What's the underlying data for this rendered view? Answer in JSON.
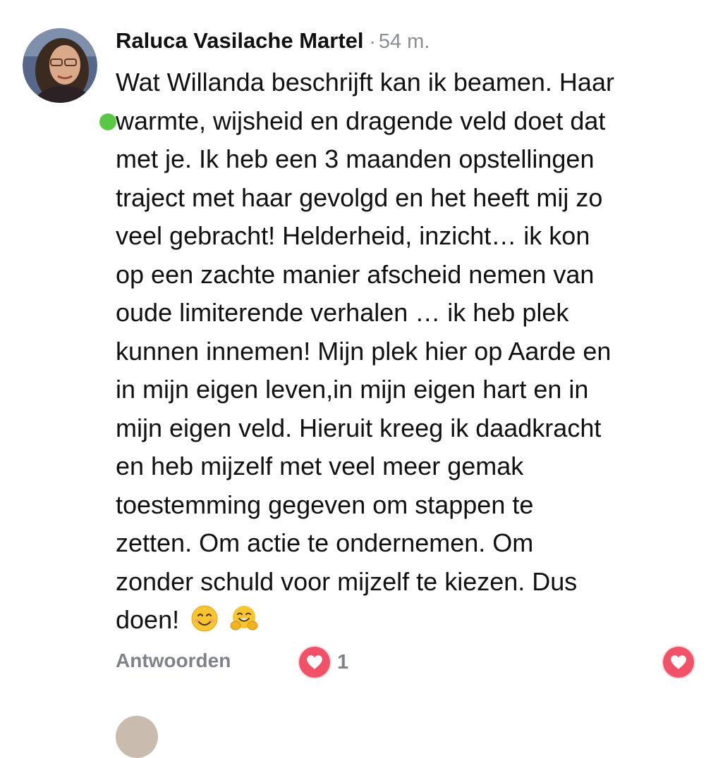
{
  "comment": {
    "author": "Raluca Vasilache Martel",
    "separator": "·",
    "time": "54 m.",
    "online": true,
    "online_color": "#5ac846",
    "lines": [
      "Wat Willanda beschrijft kan ik beamen. Haar",
      "warmte, wijsheid en dragende veld doet dat",
      "met je. Ik heb een 3 maanden opstellingen",
      "traject met haar gevolgd en het heeft mij zo",
      "veel gebracht! Helderheid, inzicht… ik kon",
      "op een zachte manier afscheid nemen van",
      "oude limiterende verhalen … ik heb plek",
      "kunnen innemen! Mijn plek hier op Aarde en",
      "in mijn eigen leven,in mijn eigen hart en in",
      "mijn eigen veld. Hieruit kreeg ik daadkracht",
      "en heb mijzelf met veel meer gemak",
      "toestemming gegeven om stappen te",
      "zetten. Om actie te ondernemen. Om",
      "zonder schuld voor mijzelf te kiezen. Dus"
    ],
    "last_line": "doen!",
    "emojis": [
      "smiling-face-icon",
      "hugging-face-icon"
    ],
    "reply_label": "Antwoorden",
    "reaction_icon": "heart-icon",
    "reaction_count": "1",
    "reaction_color": "#f25268",
    "like_icon": "heart-icon"
  }
}
